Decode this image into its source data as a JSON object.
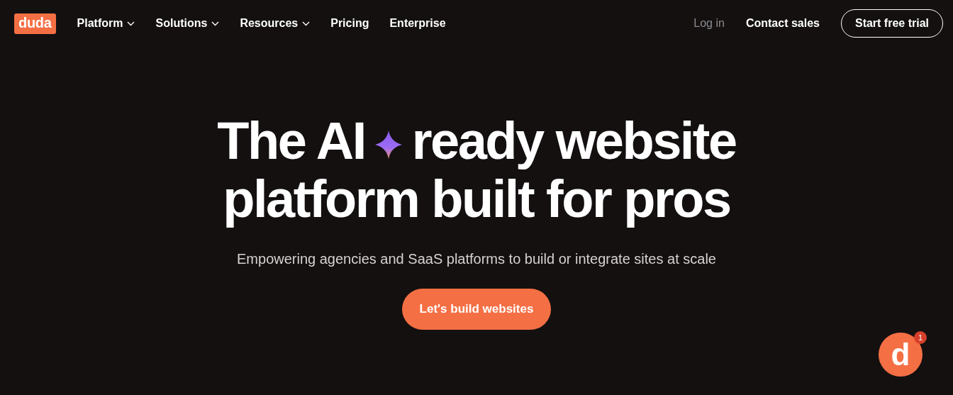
{
  "logo": {
    "text": "duda"
  },
  "nav": [
    {
      "label": "Platform",
      "has_menu": true
    },
    {
      "label": "Solutions",
      "has_menu": true
    },
    {
      "label": "Resources",
      "has_menu": true
    },
    {
      "label": "Pricing",
      "has_menu": false
    },
    {
      "label": "Enterprise",
      "has_menu": false
    }
  ],
  "actions": [
    {
      "label": "Log in",
      "kind": "muted_link"
    },
    {
      "label": "Contact sales",
      "kind": "link"
    },
    {
      "label": "Start free trial",
      "kind": "outline_button"
    }
  ],
  "hero": {
    "headline_start": "The AI",
    "headline_end": "ready website",
    "headline_line2": "platform built for pros",
    "subtitle": "Empowering agencies and SaaS platforms to build or integrate sites at scale",
    "cta": "Let's build websites"
  },
  "chat": {
    "letter": "d",
    "badge": "1"
  }
}
